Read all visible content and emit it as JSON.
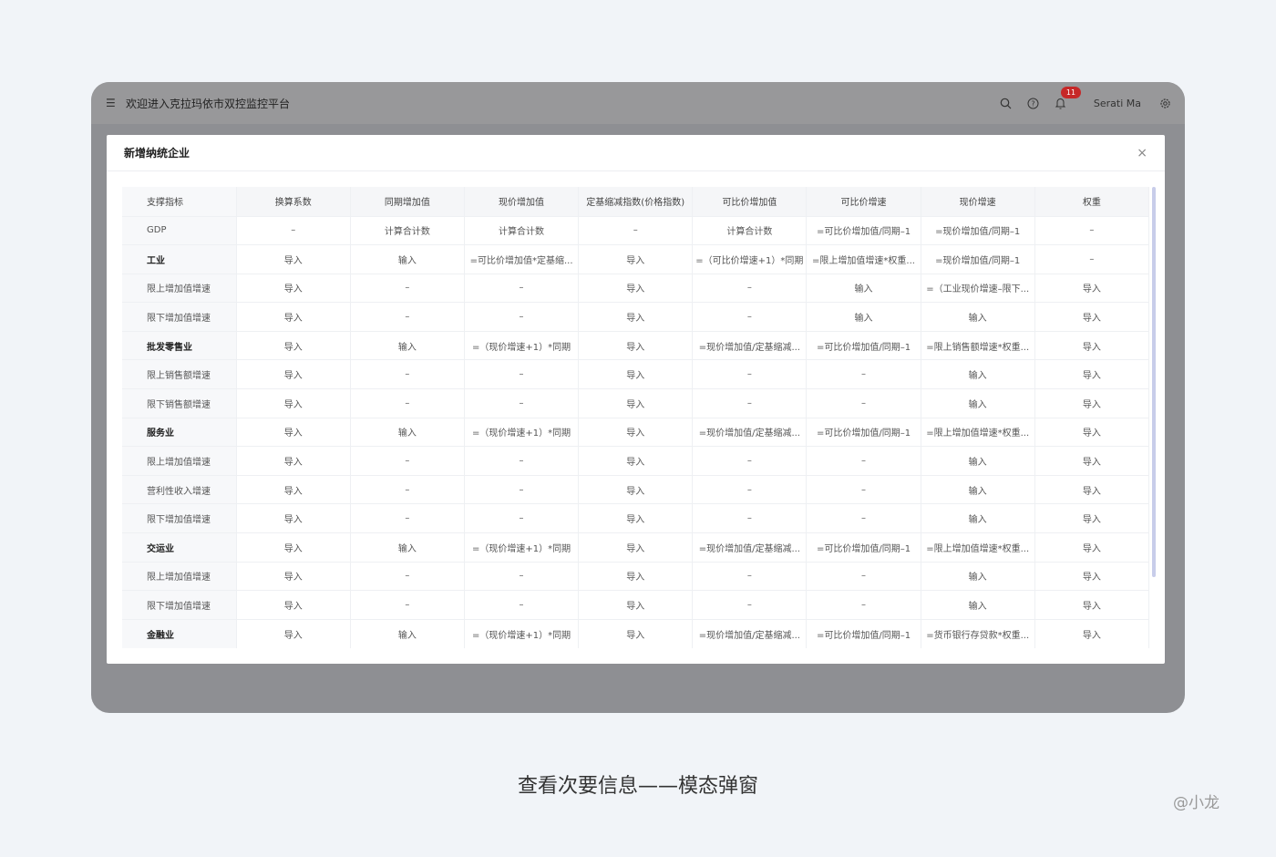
{
  "app": {
    "title": "欢迎进入克拉玛依市双控监控平台",
    "user": "Serati Ma",
    "notifications": "11",
    "icons": [
      "menu-fold-icon",
      "search-icon",
      "help-icon",
      "bell-icon",
      "gear-icon"
    ]
  },
  "modal": {
    "title": "新增纳统企业",
    "close": "×"
  },
  "table": {
    "headers": [
      "支撑指标",
      "换算系数",
      "同期增加值",
      "现价增加值",
      "定基缩减指数(价格指数)",
      "可比价增加值",
      "可比价增速",
      "现价增速",
      "权重"
    ],
    "rows": [
      {
        "bold": false,
        "cells": [
          "GDP",
          "–",
          "计算合计数",
          "计算合计数",
          "–",
          "计算合计数",
          "=可比价增加值/同期–1",
          "=现价增加值/同期–1",
          "–"
        ]
      },
      {
        "bold": true,
        "cells": [
          "工业",
          "导入",
          "输入",
          "=可比价增加值*定基缩...",
          "导入",
          "=（可比价增速+1）*同期",
          "=限上增加值增速*权重...",
          "=现价增加值/同期–1",
          "–"
        ]
      },
      {
        "bold": false,
        "cells": [
          "限上增加值增速",
          "导入",
          "–",
          "–",
          "导入",
          "–",
          "输入",
          "=（工业现价增速–限下...",
          "导入"
        ]
      },
      {
        "bold": false,
        "cells": [
          "限下增加值增速",
          "导入",
          "–",
          "–",
          "导入",
          "–",
          "输入",
          "输入",
          "导入"
        ]
      },
      {
        "bold": true,
        "cells": [
          "批发零售业",
          "导入",
          "输入",
          "=（现价增速+1）*同期",
          "导入",
          "=现价增加值/定基缩减...",
          "=可比价增加值/同期–1",
          "=限上销售额增速*权重...",
          "导入"
        ]
      },
      {
        "bold": false,
        "cells": [
          "限上销售额增速",
          "导入",
          "–",
          "–",
          "导入",
          "–",
          "–",
          "输入",
          "导入"
        ]
      },
      {
        "bold": false,
        "cells": [
          "限下销售额增速",
          "导入",
          "–",
          "–",
          "导入",
          "–",
          "–",
          "输入",
          "导入"
        ]
      },
      {
        "bold": true,
        "cells": [
          "服务业",
          "导入",
          "输入",
          "=（现价增速+1）*同期",
          "导入",
          "=现价增加值/定基缩减...",
          "=可比价增加值/同期–1",
          "=限上增加值增速*权重...",
          "导入"
        ]
      },
      {
        "bold": false,
        "cells": [
          "限上增加值增速",
          "导入",
          "–",
          "–",
          "导入",
          "–",
          "–",
          "输入",
          "导入"
        ]
      },
      {
        "bold": false,
        "cells": [
          "营利性收入增速",
          "导入",
          "–",
          "–",
          "导入",
          "–",
          "–",
          "输入",
          "导入"
        ]
      },
      {
        "bold": false,
        "cells": [
          "限下增加值增速",
          "导入",
          "–",
          "–",
          "导入",
          "–",
          "–",
          "输入",
          "导入"
        ]
      },
      {
        "bold": true,
        "cells": [
          "交运业",
          "导入",
          "输入",
          "=（现价增速+1）*同期",
          "导入",
          "=现价增加值/定基缩减...",
          "=可比价增加值/同期–1",
          "=限上增加值增速*权重...",
          "导入"
        ]
      },
      {
        "bold": false,
        "cells": [
          "限上增加值增速",
          "导入",
          "–",
          "–",
          "导入",
          "–",
          "–",
          "输入",
          "导入"
        ]
      },
      {
        "bold": false,
        "cells": [
          "限下增加值增速",
          "导入",
          "–",
          "–",
          "导入",
          "–",
          "–",
          "输入",
          "导入"
        ]
      },
      {
        "bold": true,
        "cells": [
          "金融业",
          "导入",
          "输入",
          "=（现价增速+1）*同期",
          "导入",
          "=现价增加值/定基缩减...",
          "=可比价增加值/同期–1",
          "=货币银行存贷款*权重...",
          "导入"
        ]
      }
    ]
  },
  "caption": "查看次要信息——模态弹窗",
  "signature": "@小龙"
}
